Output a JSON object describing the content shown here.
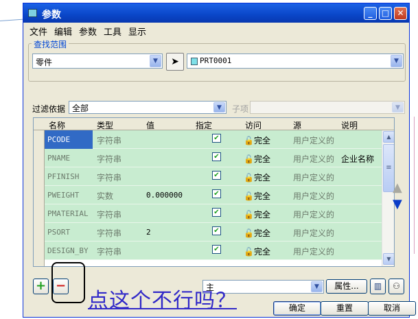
{
  "window": {
    "title": "参数",
    "controls": {
      "minimize": "_",
      "maximize": "□",
      "close": "✕"
    }
  },
  "menu": [
    "文件",
    "编辑",
    "参数",
    "工具",
    "显示"
  ],
  "search_scope": {
    "legend": "查找范围",
    "scope_value": "零件",
    "object_value": "PRT0001"
  },
  "filter": {
    "label": "过滤依据",
    "value": "全部",
    "sub_label": "子项"
  },
  "table": {
    "headers": [
      "名称",
      "类型",
      "值",
      "指定",
      "访问",
      "源",
      "说明"
    ],
    "rows": [
      {
        "name": "PCODE",
        "type": "字符串",
        "value": "",
        "designated": true,
        "access": "完全",
        "source": "用户定义的",
        "desc": ""
      },
      {
        "name": "PNAME",
        "type": "字符串",
        "value": "",
        "designated": true,
        "access": "完全",
        "source": "用户定义的",
        "desc": "企业名称"
      },
      {
        "name": "PFINISH",
        "type": "字符串",
        "value": "",
        "designated": true,
        "access": "完全",
        "source": "用户定义的",
        "desc": ""
      },
      {
        "name": "PWEIGHT",
        "type": "实数",
        "value": "0.000000",
        "designated": true,
        "access": "完全",
        "source": "用户定义的",
        "desc": ""
      },
      {
        "name": "PMATERIAL",
        "type": "字符串",
        "value": "",
        "designated": true,
        "access": "完全",
        "source": "用户定义的",
        "desc": ""
      },
      {
        "name": "PSORT",
        "type": "字符串",
        "value": "2",
        "designated": true,
        "access": "完全",
        "source": "用户定义的",
        "desc": ""
      },
      {
        "name": "DESIGN_BY",
        "type": "字符串",
        "value": "",
        "designated": true,
        "access": "完全",
        "source": "用户定义的",
        "desc": ""
      }
    ]
  },
  "bottom": {
    "add_label": "+",
    "remove_label": "−",
    "main_select_value": "主",
    "properties_label": "属性...",
    "ok_label": "确定",
    "reset_label": "重置",
    "cancel_label": "取消"
  },
  "annotation": {
    "text": "点这个不行吗？"
  }
}
